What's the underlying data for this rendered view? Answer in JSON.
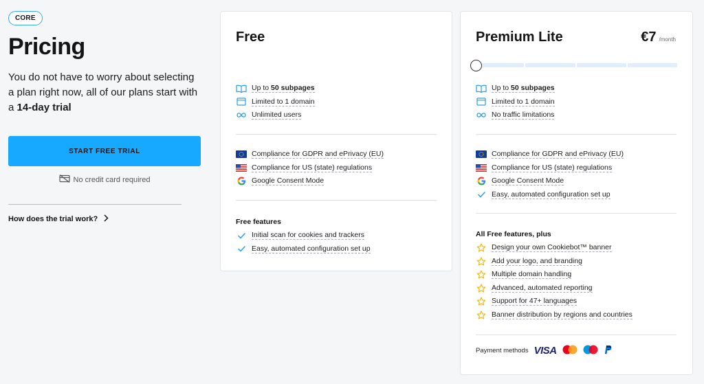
{
  "left": {
    "badge": "CORE",
    "title": "Pricing",
    "intro_text": "You do not have to worry about selecting a plan right now, all of our plans start with a ",
    "intro_bold": "14-day trial",
    "cta_label": "START FREE TRIAL",
    "no_credit_card": "No credit card required",
    "trial_link": "How does the trial work?"
  },
  "free": {
    "title": "Free",
    "limits": [
      {
        "icon": "book-icon",
        "prefix": "Up to ",
        "bold": "50 subpages"
      },
      {
        "icon": "window-icon",
        "prefix": "Limited to 1 domain",
        "bold": ""
      },
      {
        "icon": "infinity-icon",
        "prefix": "Unlimited users",
        "bold": ""
      }
    ],
    "compliance": [
      {
        "icon": "eu-flag-icon",
        "label": "Compliance for GDPR and ePrivacy (EU)"
      },
      {
        "icon": "us-flag-icon",
        "label": "Compliance for US (state) regulations"
      },
      {
        "icon": "google-icon",
        "label": "Google Consent Mode"
      }
    ],
    "features_title": "Free features",
    "features": [
      "Initial scan for cookies and trackers",
      "Easy, automated configuration set up"
    ]
  },
  "premium": {
    "title": "Premium Lite",
    "price": "€7",
    "price_unit": "/month",
    "slider_level": 0,
    "limits": [
      {
        "icon": "book-icon",
        "prefix": "Up to ",
        "bold": "50 subpages"
      },
      {
        "icon": "window-icon",
        "prefix": "Limited to 1 domain",
        "bold": ""
      },
      {
        "icon": "infinity-icon",
        "prefix": "No traffic limitations",
        "bold": ""
      }
    ],
    "compliance": [
      {
        "icon": "eu-flag-icon",
        "label": "Compliance for GDPR and ePrivacy (EU)"
      },
      {
        "icon": "us-flag-icon",
        "label": "Compliance for US (state) regulations"
      },
      {
        "icon": "google-icon",
        "label": "Google Consent Mode"
      },
      {
        "icon": "check-icon",
        "label": "Easy, automated configuration set up"
      }
    ],
    "features_title": "All Free features, plus",
    "features": [
      "Design your own Cookiebot™ banner",
      "Add your logo, and branding",
      "Multiple domain handling",
      "Advanced, automated reporting",
      "Support for 47+ languages",
      "Banner distribution by regions and countries"
    ],
    "payment_label": "Payment methods",
    "visa": "VISA"
  },
  "colors": {
    "accent": "#17a8ff",
    "star": "#f0b400",
    "check": "#2a9ee8"
  }
}
